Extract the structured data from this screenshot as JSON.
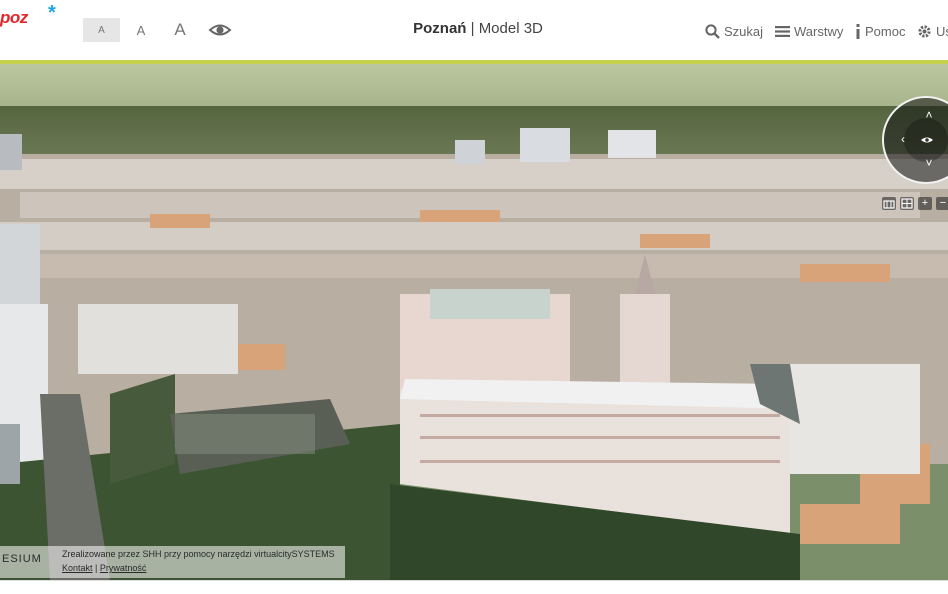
{
  "header": {
    "logo_text": "poz",
    "logo_star": "*",
    "font_sizes": [
      "A",
      "A",
      "A"
    ],
    "title_city": "Poznań",
    "title_separator": " | ",
    "title_mode": "Model 3D",
    "nav": {
      "search": "Szukaj",
      "layers": "Warstwy",
      "help": "Pomoc",
      "user": "Us"
    },
    "icons": {
      "accessibility": "eye-icon",
      "search": "magnifier-icon",
      "layers": "menu-lines-icon",
      "help": "info-icon",
      "user": "gear-icon"
    }
  },
  "attribution": {
    "engine": "ESIUM",
    "text": "Zrealizowane przez SHH przy pomocy narzędzi virtualcitySYSTEMS",
    "contact": "Kontakt",
    "separator": " | ",
    "privacy": "Prywatność"
  },
  "compass": {
    "up": "˄",
    "down": "˅",
    "left": "‹",
    "center": "eye-icon"
  },
  "tools": {
    "buildings": "building-icon",
    "grid": "grid-icon",
    "zoom_in": "+",
    "zoom_out": "−"
  },
  "colors": {
    "accent_line": "#c5d14a",
    "logo_red": "#e3262a",
    "logo_star": "#1aa7e0"
  }
}
